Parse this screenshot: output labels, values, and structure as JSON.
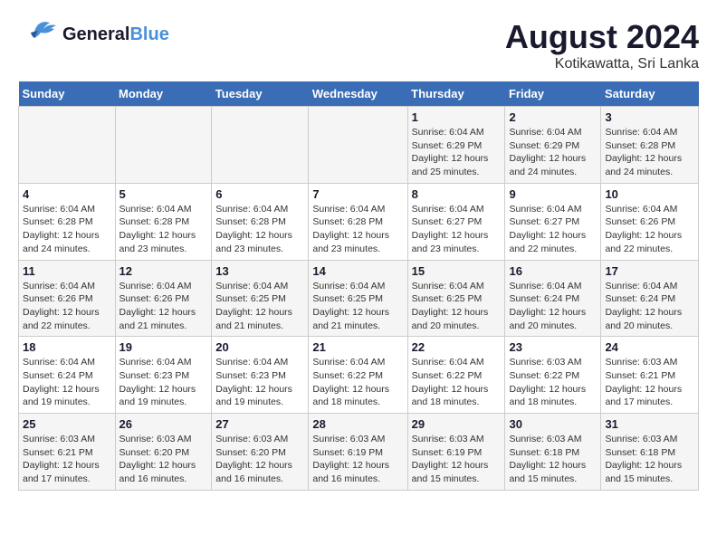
{
  "header": {
    "logo_general": "General",
    "logo_blue": "Blue",
    "title": "August 2024",
    "subtitle": "Kotikawatta, Sri Lanka"
  },
  "days_of_week": [
    "Sunday",
    "Monday",
    "Tuesday",
    "Wednesday",
    "Thursday",
    "Friday",
    "Saturday"
  ],
  "weeks": [
    [
      {
        "day": "",
        "info": ""
      },
      {
        "day": "",
        "info": ""
      },
      {
        "day": "",
        "info": ""
      },
      {
        "day": "",
        "info": ""
      },
      {
        "day": "1",
        "info": "Sunrise: 6:04 AM\nSunset: 6:29 PM\nDaylight: 12 hours and 25 minutes."
      },
      {
        "day": "2",
        "info": "Sunrise: 6:04 AM\nSunset: 6:29 PM\nDaylight: 12 hours and 24 minutes."
      },
      {
        "day": "3",
        "info": "Sunrise: 6:04 AM\nSunset: 6:28 PM\nDaylight: 12 hours and 24 minutes."
      }
    ],
    [
      {
        "day": "4",
        "info": "Sunrise: 6:04 AM\nSunset: 6:28 PM\nDaylight: 12 hours and 24 minutes."
      },
      {
        "day": "5",
        "info": "Sunrise: 6:04 AM\nSunset: 6:28 PM\nDaylight: 12 hours and 23 minutes."
      },
      {
        "day": "6",
        "info": "Sunrise: 6:04 AM\nSunset: 6:28 PM\nDaylight: 12 hours and 23 minutes."
      },
      {
        "day": "7",
        "info": "Sunrise: 6:04 AM\nSunset: 6:28 PM\nDaylight: 12 hours and 23 minutes."
      },
      {
        "day": "8",
        "info": "Sunrise: 6:04 AM\nSunset: 6:27 PM\nDaylight: 12 hours and 23 minutes."
      },
      {
        "day": "9",
        "info": "Sunrise: 6:04 AM\nSunset: 6:27 PM\nDaylight: 12 hours and 22 minutes."
      },
      {
        "day": "10",
        "info": "Sunrise: 6:04 AM\nSunset: 6:26 PM\nDaylight: 12 hours and 22 minutes."
      }
    ],
    [
      {
        "day": "11",
        "info": "Sunrise: 6:04 AM\nSunset: 6:26 PM\nDaylight: 12 hours and 22 minutes."
      },
      {
        "day": "12",
        "info": "Sunrise: 6:04 AM\nSunset: 6:26 PM\nDaylight: 12 hours and 21 minutes."
      },
      {
        "day": "13",
        "info": "Sunrise: 6:04 AM\nSunset: 6:25 PM\nDaylight: 12 hours and 21 minutes."
      },
      {
        "day": "14",
        "info": "Sunrise: 6:04 AM\nSunset: 6:25 PM\nDaylight: 12 hours and 21 minutes."
      },
      {
        "day": "15",
        "info": "Sunrise: 6:04 AM\nSunset: 6:25 PM\nDaylight: 12 hours and 20 minutes."
      },
      {
        "day": "16",
        "info": "Sunrise: 6:04 AM\nSunset: 6:24 PM\nDaylight: 12 hours and 20 minutes."
      },
      {
        "day": "17",
        "info": "Sunrise: 6:04 AM\nSunset: 6:24 PM\nDaylight: 12 hours and 20 minutes."
      }
    ],
    [
      {
        "day": "18",
        "info": "Sunrise: 6:04 AM\nSunset: 6:24 PM\nDaylight: 12 hours and 19 minutes."
      },
      {
        "day": "19",
        "info": "Sunrise: 6:04 AM\nSunset: 6:23 PM\nDaylight: 12 hours and 19 minutes."
      },
      {
        "day": "20",
        "info": "Sunrise: 6:04 AM\nSunset: 6:23 PM\nDaylight: 12 hours and 19 minutes."
      },
      {
        "day": "21",
        "info": "Sunrise: 6:04 AM\nSunset: 6:22 PM\nDaylight: 12 hours and 18 minutes."
      },
      {
        "day": "22",
        "info": "Sunrise: 6:04 AM\nSunset: 6:22 PM\nDaylight: 12 hours and 18 minutes."
      },
      {
        "day": "23",
        "info": "Sunrise: 6:03 AM\nSunset: 6:22 PM\nDaylight: 12 hours and 18 minutes."
      },
      {
        "day": "24",
        "info": "Sunrise: 6:03 AM\nSunset: 6:21 PM\nDaylight: 12 hours and 17 minutes."
      }
    ],
    [
      {
        "day": "25",
        "info": "Sunrise: 6:03 AM\nSunset: 6:21 PM\nDaylight: 12 hours and 17 minutes."
      },
      {
        "day": "26",
        "info": "Sunrise: 6:03 AM\nSunset: 6:20 PM\nDaylight: 12 hours and 16 minutes."
      },
      {
        "day": "27",
        "info": "Sunrise: 6:03 AM\nSunset: 6:20 PM\nDaylight: 12 hours and 16 minutes."
      },
      {
        "day": "28",
        "info": "Sunrise: 6:03 AM\nSunset: 6:19 PM\nDaylight: 12 hours and 16 minutes."
      },
      {
        "day": "29",
        "info": "Sunrise: 6:03 AM\nSunset: 6:19 PM\nDaylight: 12 hours and 15 minutes."
      },
      {
        "day": "30",
        "info": "Sunrise: 6:03 AM\nSunset: 6:18 PM\nDaylight: 12 hours and 15 minutes."
      },
      {
        "day": "31",
        "info": "Sunrise: 6:03 AM\nSunset: 6:18 PM\nDaylight: 12 hours and 15 minutes."
      }
    ]
  ]
}
